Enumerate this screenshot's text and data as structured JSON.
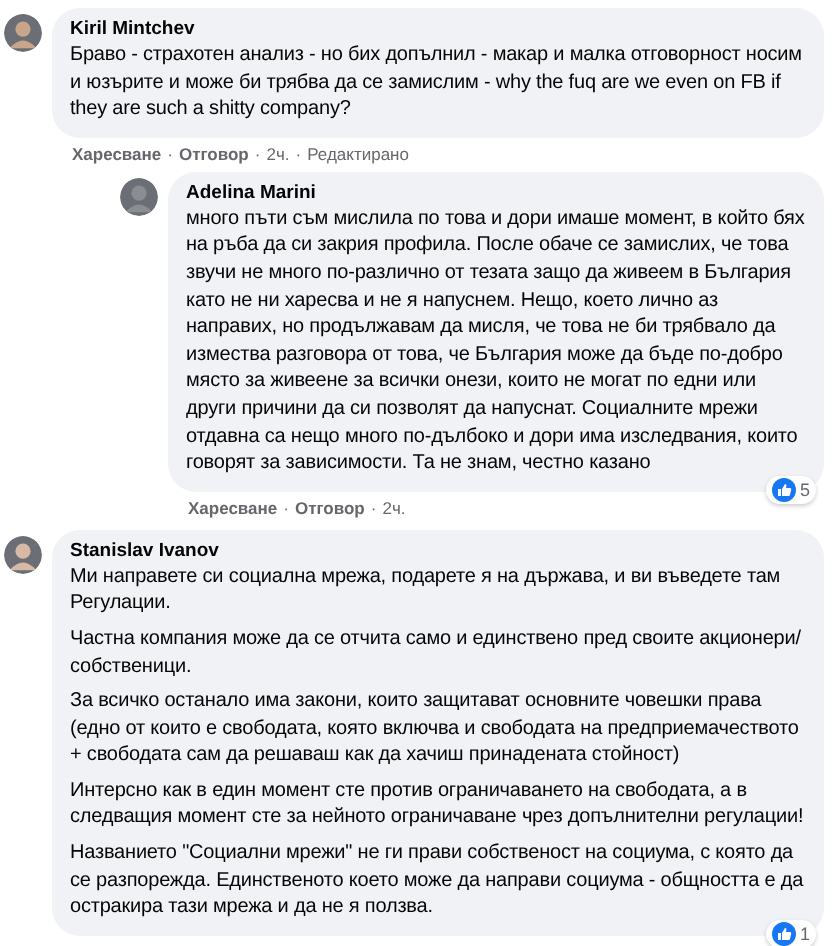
{
  "comments": [
    {
      "author": "Kiril Mintchev",
      "paragraphs": [
        "Браво - страхотен анализ - но бих допълнил - макар и малка отговорност носим и юзърите и може би трябва да се замислим - why the fuq are we even on FB if they are such a shitty company?"
      ],
      "actions": [
        {
          "kind": "link",
          "label": "Харесване"
        },
        {
          "kind": "sep",
          "label": "·"
        },
        {
          "kind": "link",
          "label": "Отговор"
        },
        {
          "kind": "sep",
          "label": "·"
        },
        {
          "kind": "text",
          "label": "2ч."
        },
        {
          "kind": "sep",
          "label": "·"
        },
        {
          "kind": "text",
          "label": "Редактирано"
        }
      ],
      "children": [
        {
          "author": "Adelina Marini",
          "paragraphs": [
            "много пъти съм мислила по това и дори имаше момент, в който бях на ръба да си закрия профила. После обаче се замислих, че това звучи не много по-различно от тезата защо да живеем в България като не ни харесва и не я напуснем. Нещо, което лично аз направих, но продължавам да мисля, че това не би трябвало да измества разговора от това, че България може да бъде по-добро място за живеене за всички онези, които не могат по едни или други причини да си позволят да напуснат. Социалните мрежи отдавна са нещо много по-дълбоко и дори има изследвания, които говорят за зависимости. Та не знам, честно казано"
          ],
          "reactions": "5",
          "actions": [
            {
              "kind": "link",
              "label": "Харесване"
            },
            {
              "kind": "sep",
              "label": "·"
            },
            {
              "kind": "link",
              "label": "Отговор"
            },
            {
              "kind": "sep",
              "label": "·"
            },
            {
              "kind": "text",
              "label": "2ч."
            }
          ]
        }
      ]
    },
    {
      "author": "Stanislav Ivanov",
      "paragraphs": [
        "Ми направете си социална мрежа, подарете я на държава, и ви въведете там Регулации.",
        "Частна компания може да се отчита само и единствено пред своите акционери/собственици.",
        "За всичко останало има закони, които защитават основните човешки права (едно от които е свободата, която включва и свободата на предприемачеството + свободата сам да решаваш как да хачиш принадената стойност)",
        "Интерсно как в един момент сте против ограничаването на свободата, а в следващия момент сте за нейното ограничаване чрез допълнителни регулации!",
        "Названието \"Социални мрежи\" не ги прави собственост на социума, с която да се разпорежда. Единственото което може да направи социума - общността е да остракира тази мрежа и да не я ползва."
      ],
      "reactions": "1"
    }
  ]
}
